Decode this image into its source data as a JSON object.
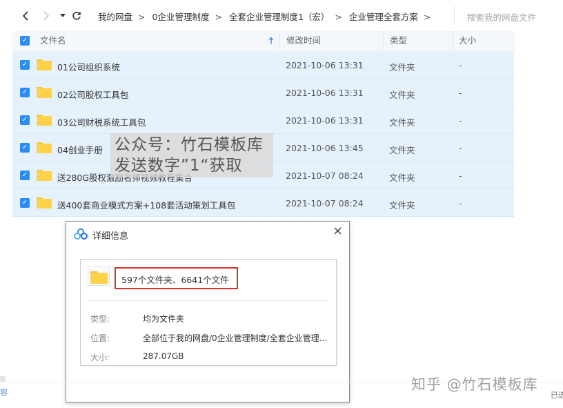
{
  "toolbar": {
    "back_icon": "chevron-left-icon",
    "forward_icon": "chevron-right-icon",
    "dropdown_icon": "caret-down-icon",
    "refresh_icon": "refresh-icon",
    "breadcrumb": [
      "我的网盘",
      "0企业管理制度",
      "全套企业管理制度1（宏）",
      "企业管理全套方案"
    ],
    "breadcrumb_sep": ">",
    "search_placeholder": "搜索我的网盘文件"
  },
  "table": {
    "headers": {
      "name": "文件名",
      "time": "修改时间",
      "type": "类型",
      "size": "大小"
    },
    "sort_icon": "arrow-up-icon",
    "rows": [
      {
        "name": "01公司组织系统",
        "time": "2021-10-06 13:31",
        "type": "文件夹",
        "size": "-"
      },
      {
        "name": "02公司股权工具包",
        "time": "2021-10-06 13:31",
        "type": "文件夹",
        "size": "-"
      },
      {
        "name": "03公司财税系统工具包",
        "time": "2021-10-06 13:31",
        "type": "文件夹",
        "size": "-"
      },
      {
        "name": "04创业手册",
        "time": "2021-10-06 13:45",
        "type": "文件夹",
        "size": "-"
      },
      {
        "name": "送280G股权激励名师视频教程集合",
        "time": "2021-10-07 08:24",
        "type": "文件夹",
        "size": "-"
      },
      {
        "name": "送400套商业模式方案+108套活动策划工具包",
        "time": "2021-10-07 08:24",
        "type": "文件夹",
        "size": "-"
      }
    ]
  },
  "watermark": {
    "line1": "公众号：竹石模板库",
    "line2": "发送数字”1“获取"
  },
  "dialog": {
    "title": "详细信息",
    "close": "×",
    "summary": "597个文件夹、6641个文件",
    "props": [
      {
        "label": "类型:",
        "value": "均为文件夹"
      },
      {
        "label": "位置:",
        "value": "全部位于我的网盘/0企业管理制度/全套企业管理..."
      },
      {
        "label": "大小:",
        "value": "287.07GB"
      }
    ]
  },
  "footer": {
    "zhihu_watermark": "知乎 @竹石模板库",
    "left_edge_text": "容",
    "status_right": "已选"
  },
  "colors": {
    "accent": "#2d8cf0",
    "row_selected": "#e6f2fb",
    "highlight_border": "#d8322c",
    "folder": "#fdd24a"
  }
}
